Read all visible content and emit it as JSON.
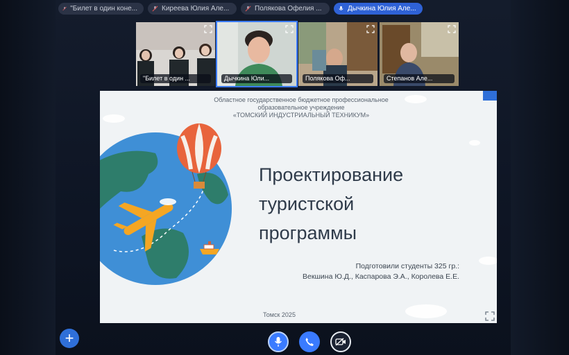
{
  "participant_tabs": [
    {
      "label": "\"Билет в один коне..."
    },
    {
      "label": "Киреева Юлия Але..."
    },
    {
      "label": "Полякова Офелия ..."
    },
    {
      "label": "Дычкина Юлия Але..."
    }
  ],
  "video_tiles": [
    {
      "label": "\"Билет в один ..."
    },
    {
      "label": "Дычкина Юли..."
    },
    {
      "label": "Полякова Оф..."
    },
    {
      "label": "Степанов Але..."
    }
  ],
  "slide": {
    "header_line1": "Областное государственное бюджетное профессиональное",
    "header_line2": "образовательное учреждение",
    "header_line3": "«ТОМСКИЙ ИНДУСТРИАЛЬНЫЙ ТЕХНИКУМ»",
    "title_line1": "Проектирование",
    "title_line2": "туристской",
    "title_line3": "программы",
    "authors_line1": "Подготовили студенты 325 гр.:",
    "authors_line2": "Векшина Ю.Д., Каспарова Э.А., Королева Е.Е.",
    "city_year": "Томск 2025"
  },
  "controls": {
    "add_label": "+"
  },
  "colors": {
    "accent": "#3a7bff",
    "slide_bg": "#f0f3f5",
    "globe_ocean": "#3f8fd6",
    "globe_land": "#2e7d6b",
    "plane": "#f5a623",
    "balloon": "#e8643c"
  }
}
